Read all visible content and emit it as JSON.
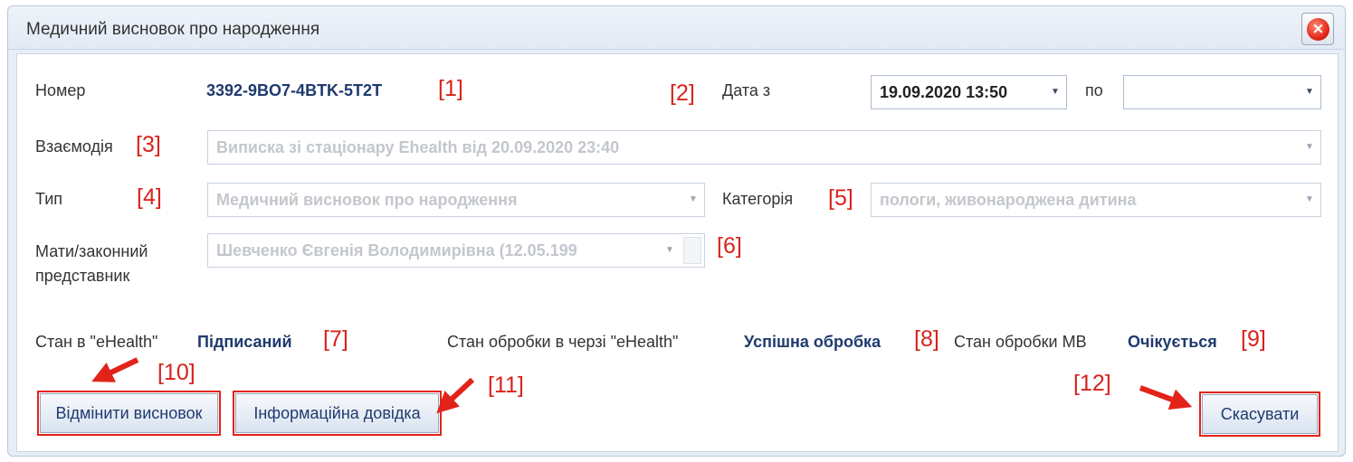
{
  "window": {
    "title": "Медичний висновок про народження",
    "close_icon": "×"
  },
  "fields": {
    "number_label": "Номер",
    "number_value": "3392-9BO7-4BTK-5T2T",
    "date_from_label": "Дата з",
    "date_from_value": "19.09.2020 13:50",
    "date_to_label": "по",
    "date_to_value": "",
    "interaction_label": "Взаємодія",
    "interaction_value": "Виписка зі стаціонару Ehealth від 20.09.2020 23:40",
    "type_label": "Тип",
    "type_value": "Медичний висновок про народження",
    "category_label": "Категорія",
    "category_value": "пологи, живонароджена дитина",
    "mother_label_line1": "Мати/законний",
    "mother_label_line2": "представник",
    "mother_value": "Шевченко Євгенія Володимирівна (12.05.199"
  },
  "status": {
    "ehealth_label": "Стан в \"eHealth\"",
    "ehealth_value": "Підписаний",
    "queue_label": "Стан обробки в черзі \"eHealth\"",
    "queue_value": "Успішна обробка",
    "mv_label": "Стан обробки МВ",
    "mv_value": "Очікується"
  },
  "buttons": {
    "cancel_conclusion": "Відмінити висновок",
    "info_reference": "Інформаційна довідка",
    "cancel": "Скасувати"
  },
  "markers": {
    "m1": "[1]",
    "m2": "[2]",
    "m3": "[3]",
    "m4": "[4]",
    "m5": "[5]",
    "m6": "[6]",
    "m7": "[7]",
    "m8": "[8]",
    "m9": "[9]",
    "m10": "[10]",
    "m11": "[11]",
    "m12": "[12]"
  },
  "colors": {
    "annotation": "#e2231a",
    "value_text": "#1f3a6e"
  },
  "icons": {
    "dropdown": "chevron-down-icon",
    "close": "close-icon",
    "arrow": "red-arrow-icon"
  }
}
